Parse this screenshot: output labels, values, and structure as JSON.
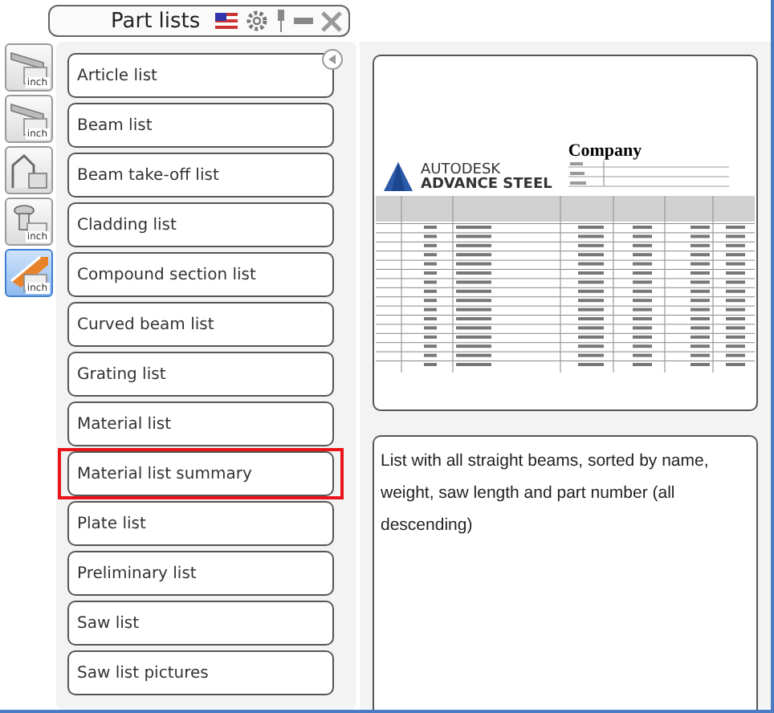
{
  "window": {
    "title": "Part lists"
  },
  "toolbar": [
    {
      "kind": "beam",
      "badge": "inch",
      "selected": false
    },
    {
      "kind": "beam",
      "badge": "inch",
      "selected": false
    },
    {
      "kind": "takeoff",
      "selected": false
    },
    {
      "kind": "bolt",
      "badge": "inch",
      "selected": false
    },
    {
      "kind": "plate",
      "badge": "inch",
      "selected": true
    }
  ],
  "lists": [
    {
      "label": "Article list",
      "selected": false
    },
    {
      "label": "Beam list",
      "selected": false
    },
    {
      "label": "Beam take-off list",
      "selected": false
    },
    {
      "label": "Cladding list",
      "selected": false
    },
    {
      "label": "Compound section list",
      "selected": false
    },
    {
      "label": "Curved beam list",
      "selected": false
    },
    {
      "label": "Grating list",
      "selected": false
    },
    {
      "label": "Material list",
      "selected": false
    },
    {
      "label": "Material list summary",
      "selected": true
    },
    {
      "label": "Plate list",
      "selected": false
    },
    {
      "label": "Preliminary list",
      "selected": false
    },
    {
      "label": "Saw list",
      "selected": false
    },
    {
      "label": "Saw list pictures",
      "selected": false
    }
  ],
  "preview": {
    "logo_top": "AUTODESK",
    "logo_bottom": "ADVANCE STEEL",
    "company": "Company"
  },
  "description": "List with all straight beams, sorted by name, weight, saw length and part number (all descending)"
}
